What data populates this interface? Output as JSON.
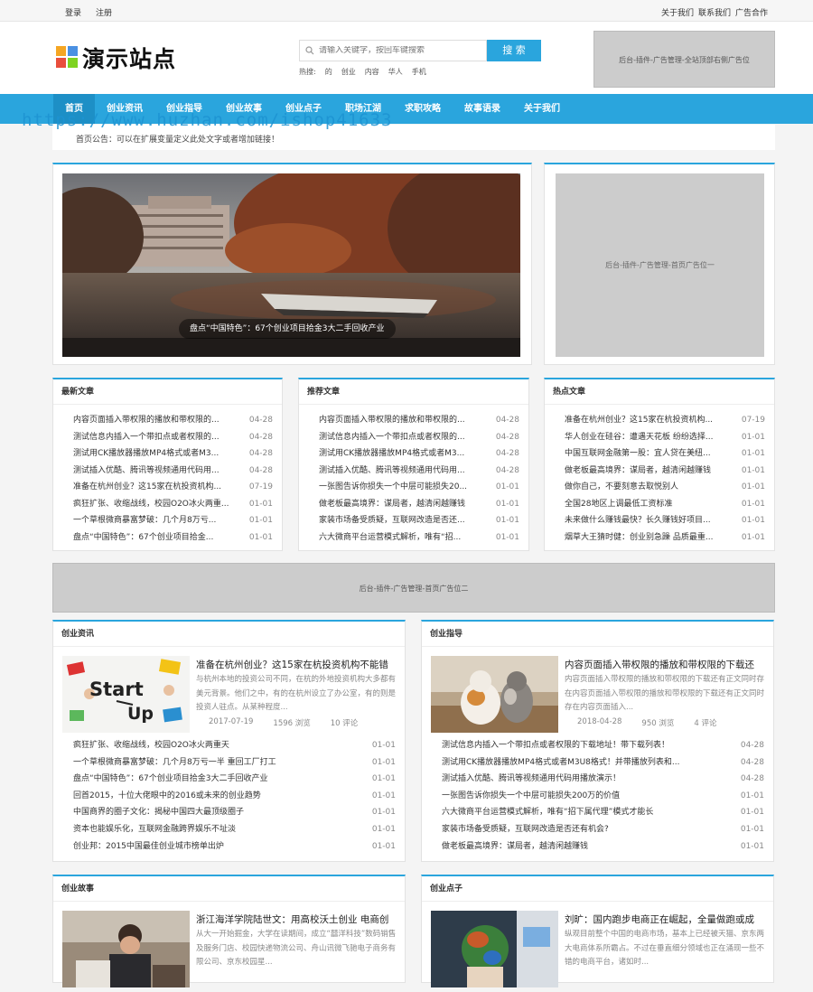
{
  "topbar": {
    "left": [
      "登录",
      "注册"
    ],
    "right": [
      "关于我们",
      "联系我们",
      "广告合作"
    ]
  },
  "header": {
    "logo_text": "演示站点",
    "search_placeholder": "请输入关键字，按回车键搜索",
    "search_button": "搜 索",
    "hot_label": "热搜:",
    "hot_words": [
      "的",
      "创业",
      "内容",
      "华人",
      "手机"
    ],
    "ad_text": "后台-插件-广告管理-全站顶部右侧广告位"
  },
  "nav": [
    "首页",
    "创业资讯",
    "创业指导",
    "创业故事",
    "创业点子",
    "职场江湖",
    "求职攻略",
    "故事语录",
    "关于我们"
  ],
  "watermark": "https://www.huzhan.com/ishop41633",
  "notice": "首页公告：可以在扩展变量定义此处文字或者增加链接！",
  "slider": {
    "caption": "盘点“中国特色”：67个创业项目拾金3大二手回收产业"
  },
  "ad_side": "后台-插件-广告管理-首页广告位一",
  "ad_wide": "后台-插件-广告管理-首页广告位二",
  "lists": [
    {
      "title": "最新文章",
      "items": [
        {
          "t": "内容页面插入带权限的播放和带权限的...",
          "d": "04-28"
        },
        {
          "t": "测试信息内插入一个带扣点或者权限的...",
          "d": "04-28"
        },
        {
          "t": "测试用CK播放器播放MP4格式或者M3...",
          "d": "04-28"
        },
        {
          "t": "测试插入优酷、腾讯等视频通用代码用...",
          "d": "04-28"
        },
        {
          "t": "准备在杭州创业？这15家在杭投资机构...",
          "d": "07-19"
        },
        {
          "t": "疯狂扩张、收缩战线，校园O2O冰火两重...",
          "d": "01-01"
        },
        {
          "t": "一个草根微商暴富梦破：几个月8万亏...",
          "d": "01-01"
        },
        {
          "t": "盘点“中国特色”：67个创业项目拾金...",
          "d": "01-01"
        }
      ]
    },
    {
      "title": "推荐文章",
      "items": [
        {
          "t": "内容页面插入带权限的播放和带权限的...",
          "d": "04-28"
        },
        {
          "t": "测试信息内插入一个带扣点或者权限的...",
          "d": "04-28"
        },
        {
          "t": "测试用CK播放器播放MP4格式或者M3...",
          "d": "04-28"
        },
        {
          "t": "测试插入优酷、腾讯等视频通用代码用...",
          "d": "04-28"
        },
        {
          "t": "一张图告诉你损失一个中层可能损失20...",
          "d": "01-01"
        },
        {
          "t": "做老板最高境界：谋局者，越清闲越赚钱",
          "d": "01-01"
        },
        {
          "t": "家装市场备受质疑，互联网改造是否还...",
          "d": "01-01"
        },
        {
          "t": "六大微商平台运营模式解析，唯有“招...",
          "d": "01-01"
        }
      ]
    },
    {
      "title": "热点文章",
      "items": [
        {
          "t": "准备在杭州创业？这15家在杭投资机构...",
          "d": "07-19"
        },
        {
          "t": "华人创业在硅谷：遭遇天花板 纷纷选择...",
          "d": "01-01"
        },
        {
          "t": "中国互联网金融第一股：宜人贷在美纽...",
          "d": "01-01"
        },
        {
          "t": "做老板最高境界：谋局者，越清闲越赚钱",
          "d": "01-01"
        },
        {
          "t": "做你自己，不要刻意去取悦别人",
          "d": "01-01"
        },
        {
          "t": "全国28地区上调最低工资标准",
          "d": "01-01"
        },
        {
          "t": "未来做什么赚钱最快？长久赚钱好项目...",
          "d": "01-01"
        },
        {
          "t": "烟草大王猜时健：创业别急躁 品质最重...",
          "d": "01-01"
        }
      ]
    }
  ],
  "categories": [
    {
      "title": "创业资讯",
      "feature": {
        "title": "准备在杭州创业？这15家在杭投资机构不能错",
        "desc": "与杭州本地的投资公司不同，在杭的外地投资机构大多都有美元背景。他们之中，有的在杭州设立了办公室，有的则是投资人驻点。从某种程度...",
        "date": "2017-07-19",
        "views": "1596 浏览",
        "comments": "10 评论"
      },
      "items": [
        {
          "t": "疯狂扩张、收缩战线，校园O2O冰火两重天",
          "d": "01-01"
        },
        {
          "t": "一个草根微商暴富梦破：几个月8万亏一半 重回工厂打工",
          "d": "01-01"
        },
        {
          "t": "盘点“中国特色”：67个创业项目拾金3大二手回收产业",
          "d": "01-01"
        },
        {
          "t": "回首2015，十位大佬眼中的2016或未来的创业趋势",
          "d": "01-01"
        },
        {
          "t": "中国商界的圈子文化：揭秘中国四大最顶级圈子",
          "d": "01-01"
        },
        {
          "t": "资本也能娱乐化，互联网金融跨界娱乐不址淡",
          "d": "01-01"
        },
        {
          "t": "创业邦：2015中国最佳创业城市榜单出炉",
          "d": "01-01"
        }
      ]
    },
    {
      "title": "创业指导",
      "feature": {
        "title": "内容页面插入带权限的播放和带权限的下载还",
        "desc": "内容页面插入带权限的播放和带权限的下载还有正文同时存在内容页面插入带权限的播放和带权限的下载还有正文同时存在内容页面插入...",
        "date": "2018-04-28",
        "views": "950 浏览",
        "comments": "4 评论"
      },
      "items": [
        {
          "t": "测试信息内插入一个带扣点或者权限的下载地址！带下载列表！",
          "d": "04-28"
        },
        {
          "t": "测试用CK播放器播放MP4格式或者M3U8格式！并带播放列表和...",
          "d": "04-28"
        },
        {
          "t": "测试插入优酷、腾讯等视频通用代码用播放演示！",
          "d": "04-28"
        },
        {
          "t": "一张图告诉你损失一个中层可能损失200万的价值",
          "d": "01-01"
        },
        {
          "t": "六大微商平台运营模式解析，唯有“招下属代理”模式才能长",
          "d": "01-01"
        },
        {
          "t": "家装市场备受质疑，互联网改造是否还有机会?",
          "d": "01-01"
        },
        {
          "t": "做老板最高境界：谋局者，越清闲越赚钱",
          "d": "01-01"
        }
      ]
    },
    {
      "title": "创业故事",
      "feature": {
        "title": "浙江海洋学院陆世文：用高校沃土创业 电商创",
        "desc": "从大一开始掘金，大学在读期间，成立“囍洋科技”数码销售及服务门店、校园快递物流公司、舟山讯微飞驰电子商务有限公司、京东校园星..."
      }
    },
    {
      "title": "创业点子",
      "feature": {
        "title": "刘旷：国内跑步电商正在崛起，全量做跑或成",
        "desc": "纵观目前整个中国的电商市场，基本上已经被天猫、京东两大电商体系所霸占。不过在垂直细分领域也正在涌现一些不错的电商平台，诸如时..."
      }
    }
  ]
}
